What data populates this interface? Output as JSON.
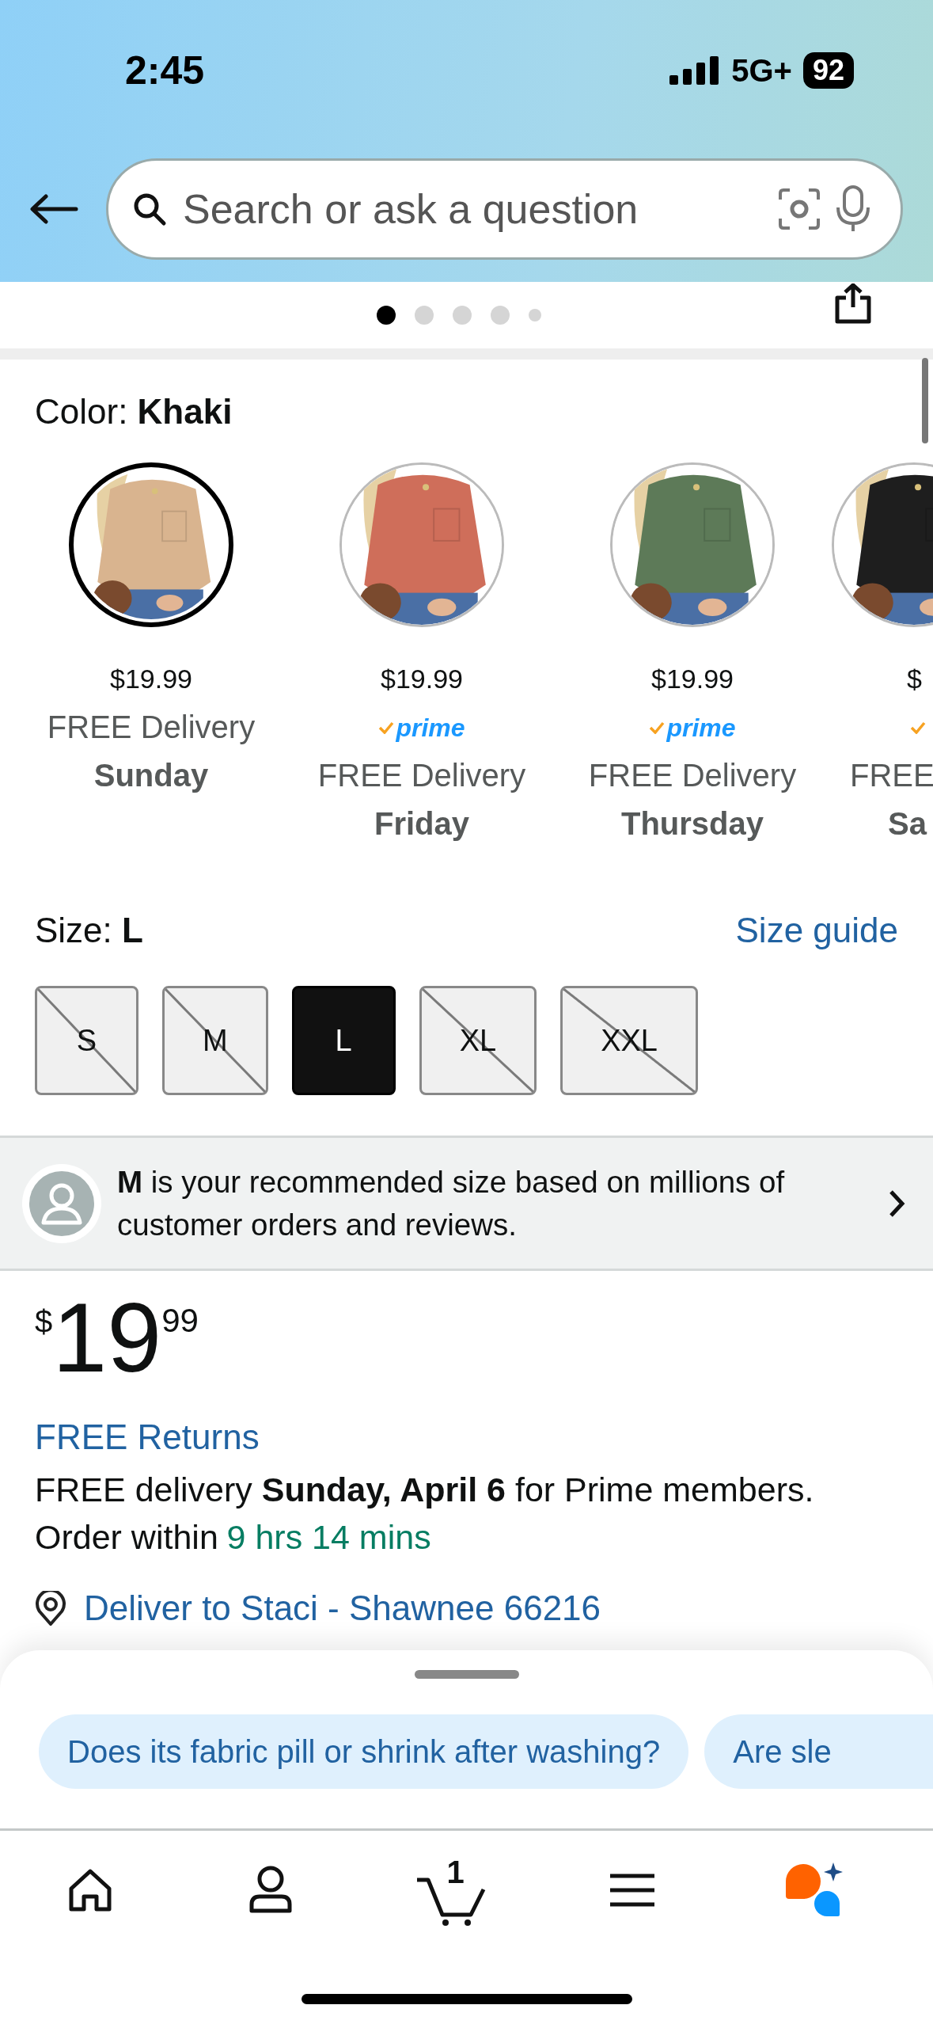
{
  "status_bar": {
    "time": "2:45",
    "network": "5G+",
    "battery": "92"
  },
  "search": {
    "placeholder": "Search or ask a question"
  },
  "image_dots": [
    {
      "selected": true
    },
    {
      "selected": false
    },
    {
      "selected": false
    },
    {
      "selected": false
    },
    {
      "selected": false
    }
  ],
  "color": {
    "label": "Color:",
    "value": "Khaki"
  },
  "swatches": [
    {
      "color": "#d9b48f",
      "selected": true,
      "prime": false,
      "price": "$19.99",
      "delivery": "FREE Delivery",
      "day": "Sunday"
    },
    {
      "color": "#cf6e5a",
      "selected": false,
      "prime": true,
      "badge": "prime",
      "price": "$19.99",
      "delivery": "FREE Delivery",
      "day": "Friday"
    },
    {
      "color": "#5d7a58",
      "selected": false,
      "prime": true,
      "badge": "prime",
      "price": "$19.99",
      "delivery": "FREE Delivery",
      "day": "Thursday"
    },
    {
      "color": "#1e1e1e",
      "selected": false,
      "prime": true,
      "price": "$",
      "delivery": "FREE",
      "day": "Sa"
    }
  ],
  "size": {
    "label": "Size:",
    "value": "L",
    "guide_link": "Size guide"
  },
  "sizes": [
    {
      "label": "S",
      "available": false,
      "selected": false
    },
    {
      "label": "M",
      "available": false,
      "selected": false
    },
    {
      "label": "L",
      "available": true,
      "selected": true
    },
    {
      "label": "XL",
      "available": false,
      "selected": false
    },
    {
      "label": "XXL",
      "available": false,
      "selected": false
    }
  ],
  "recommendation": {
    "text": "**M** is your recommended size based on millions of customer orders and reviews."
  },
  "price": {
    "currency": "$",
    "whole": "19",
    "fraction": "99"
  },
  "returns_link": "FREE Returns",
  "delivery": {
    "text": "FREE delivery **Sunday, April 6** for Prime members.",
    "countdown_label": "Order within",
    "countdown": "9 hrs 14 mins"
  },
  "deliver_to": "Deliver to Staci - Shawnee 66216",
  "suggestions": [
    "Does its fabric pill or shrink after washing?",
    "Are sle"
  ],
  "nav": [
    {
      "kind": "home"
    },
    {
      "kind": "account"
    },
    {
      "kind": "cart",
      "badge": "1"
    },
    {
      "kind": "menu"
    },
    {
      "kind": "assistant"
    }
  ]
}
